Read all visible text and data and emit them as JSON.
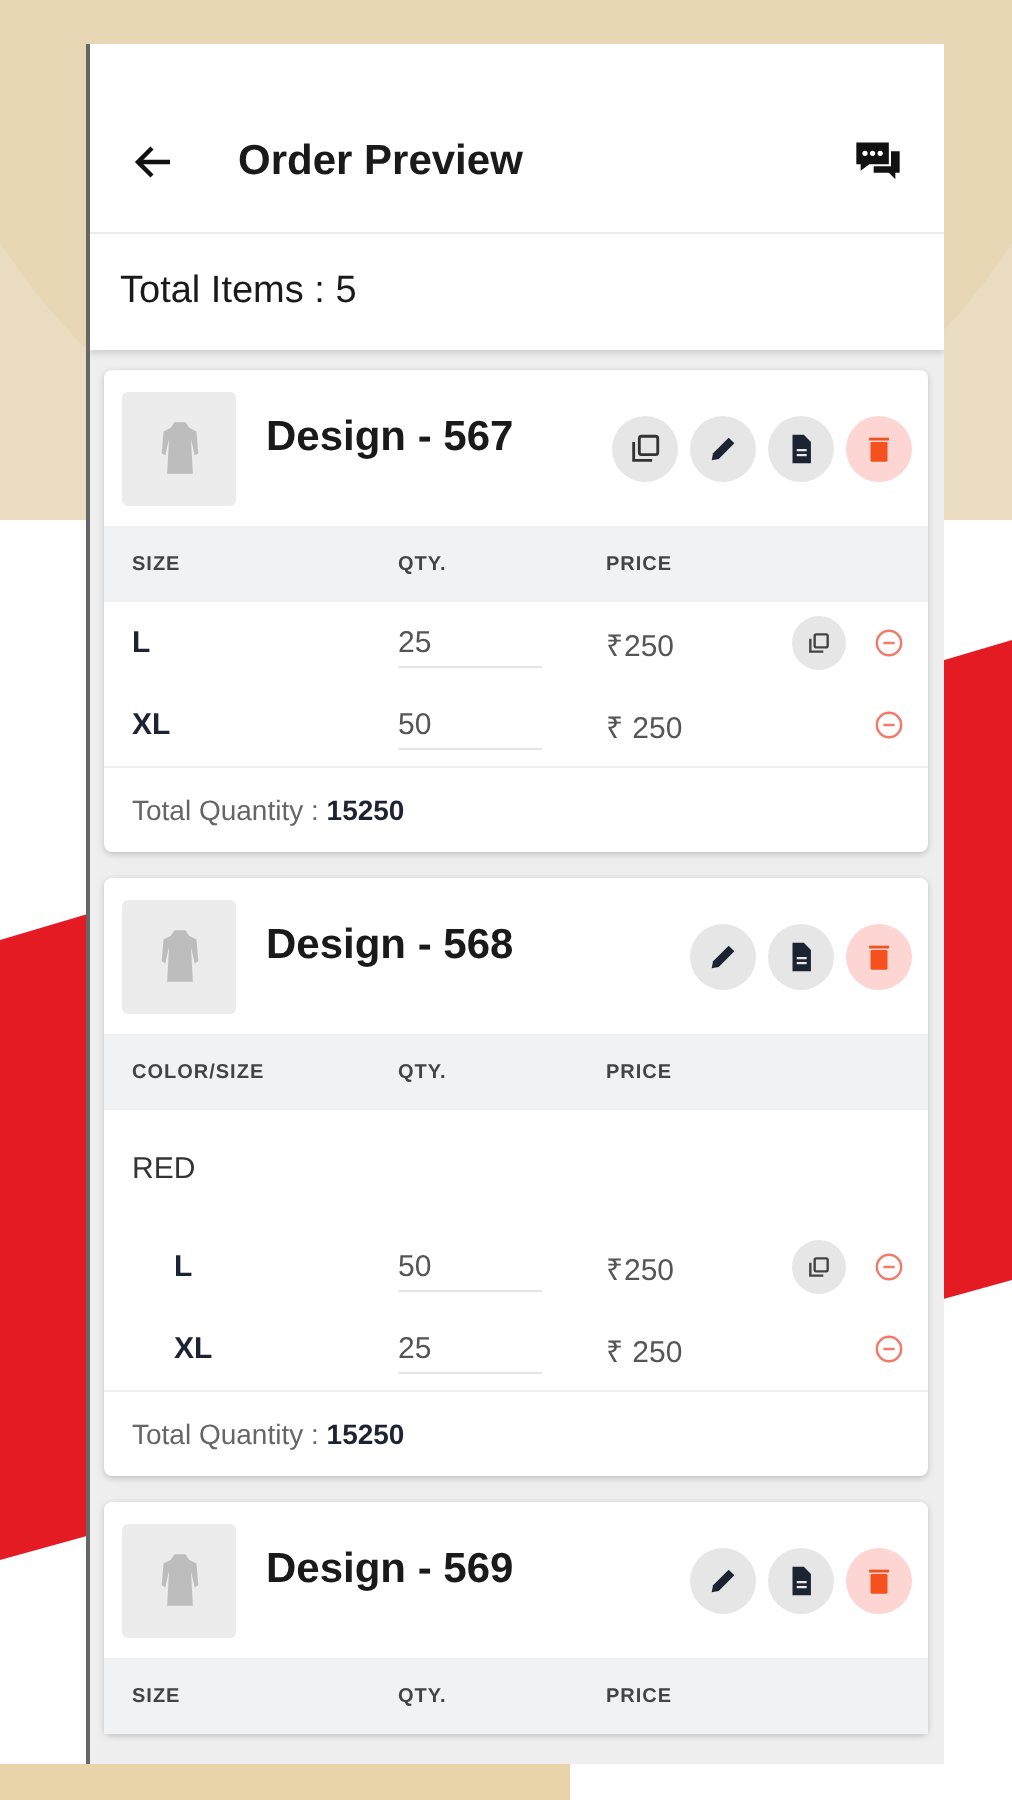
{
  "header": {
    "title": "Order Preview"
  },
  "total_items": "Total Items : 5",
  "designs": [
    {
      "title": "Design - 567",
      "actions": [
        {
          "kind": "copy"
        },
        {
          "kind": "edit"
        },
        {
          "kind": "doc"
        },
        {
          "kind": "delete"
        }
      ],
      "columns": [
        "SIZE",
        "QTY.",
        "PRICE"
      ],
      "rows": [
        {
          "kind": "size",
          "size": "L",
          "qty": "25",
          "price": "₹250",
          "copy": true
        },
        {
          "kind": "size",
          "size": "XL",
          "qty": "50",
          "price": "₹ 250",
          "copy": false
        }
      ],
      "total_label": "Total Quantity :",
      "total_value": "15250"
    },
    {
      "title": "Design - 568",
      "actions": [
        {
          "kind": "edit"
        },
        {
          "kind": "doc"
        },
        {
          "kind": "delete"
        }
      ],
      "columns": [
        "COLOR/SIZE",
        "QTY.",
        "PRICE"
      ],
      "rows": [
        {
          "kind": "color",
          "label": "RED",
          "children": [
            {
              "size": "L",
              "qty": "50",
              "price": "₹250",
              "copy": true
            },
            {
              "size": "XL",
              "qty": "25",
              "price": "₹ 250",
              "copy": false
            }
          ]
        }
      ],
      "total_label": "Total Quantity :",
      "total_value": "15250"
    },
    {
      "title": "Design - 569",
      "actions": [
        {
          "kind": "edit"
        },
        {
          "kind": "doc"
        },
        {
          "kind": "delete"
        }
      ],
      "columns": [
        "SIZE",
        "QTY.",
        "PRICE"
      ]
    }
  ]
}
